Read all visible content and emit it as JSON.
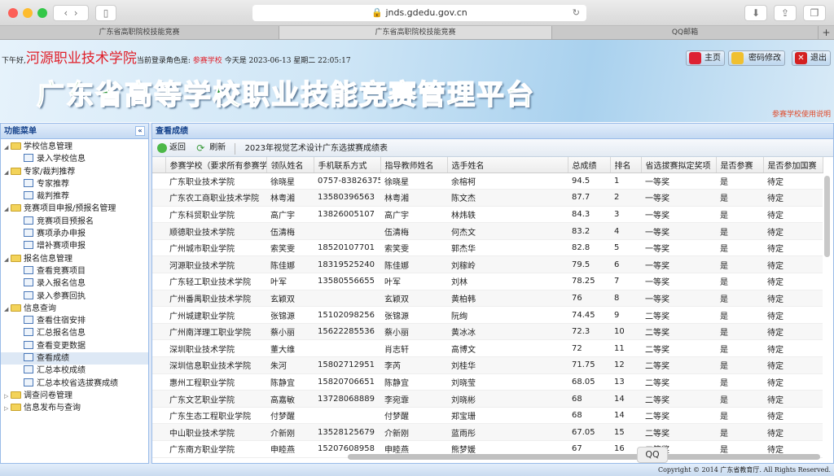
{
  "browser": {
    "url": "jnds.gdedu.gov.cn",
    "tabs": [
      "广东省高职院校技能竞赛",
      "广东省高职院校技能竞赛",
      "QQ邮箱"
    ],
    "new_tab": "+"
  },
  "header": {
    "greeting": "下午好,",
    "school": "河源职业技术学院",
    "role_prefix": "当前登录角色是:",
    "role": "参赛学校",
    "date_text": "今天是 2023-06-13 星期二 22:05:17",
    "title": "广东省高等学校职业技能竞赛管理平台",
    "buttons": {
      "home": "主页",
      "password": "密码修改",
      "logout": "退出"
    },
    "help_link": "参赛学校使用说明"
  },
  "sidebar": {
    "title": "功能菜单",
    "collapse": "«",
    "groups": [
      {
        "label": "学校信息管理",
        "open": true,
        "items": [
          "录入学校信息"
        ]
      },
      {
        "label": "专家/裁判推荐",
        "open": true,
        "items": [
          "专家推荐",
          "裁判推荐"
        ]
      },
      {
        "label": "竞赛项目申报/预报名管理",
        "open": true,
        "items": [
          "竞赛项目预报名",
          "赛项承办申报",
          "增补赛项申报"
        ]
      },
      {
        "label": "报名信息管理",
        "open": true,
        "items": [
          "查看竞赛项目",
          "录入报名信息",
          "录入参赛回执"
        ]
      },
      {
        "label": "信息查询",
        "open": true,
        "items": [
          "查看住宿安排",
          "汇总报名信息",
          "查看变更数据",
          "查看成绩",
          "汇总本校成绩",
          "汇总本校省选拔赛成绩"
        ]
      },
      {
        "label": "调查问卷管理",
        "open": false,
        "items": []
      },
      {
        "label": "信息发布与查询",
        "open": false,
        "items": []
      }
    ],
    "selected": "查看成绩"
  },
  "main": {
    "title": "查看成绩",
    "toolbar": {
      "back": "返回",
      "refresh": "刷新",
      "caption": "2023年视觉艺术设计广东选拔赛成绩表"
    },
    "columns": [
      "参赛学校（要求所有参赛学",
      "领队姓名",
      "手机联系方式",
      "指导教师姓名",
      "选手姓名",
      "总成绩",
      "排名",
      "省选拔赛拟定奖项",
      "是否参赛",
      "是否参加国赛"
    ],
    "rows": [
      [
        "广东职业技术学院",
        "徐晓星",
        "0757-83826375",
        "徐晓星",
        "余榕柯",
        "94.5",
        "1",
        "一等奖",
        "是",
        "待定"
      ],
      [
        "广东农工商职业技术学院",
        "林粤湘",
        "13580396563",
        "林粤湘",
        "陈文杰",
        "87.7",
        "2",
        "一等奖",
        "是",
        "待定"
      ],
      [
        "广东科贸职业学院",
        "高广宇",
        "13826005107",
        "高广宇",
        "林炜轶",
        "84.3",
        "3",
        "一等奖",
        "是",
        "待定"
      ],
      [
        "顺德职业技术学院",
        "伍清梅",
        "",
        "伍清梅",
        "何杰文",
        "83.2",
        "4",
        "一等奖",
        "是",
        "待定"
      ],
      [
        "广州城市职业学院",
        "索笑雯",
        "18520107701",
        "索笑雯",
        "郭杰华",
        "82.8",
        "5",
        "一等奖",
        "是",
        "待定"
      ],
      [
        "河源职业技术学院",
        "陈佳娜",
        "18319525240",
        "陈佳娜",
        "刘稼岭",
        "79.5",
        "6",
        "一等奖",
        "是",
        "待定"
      ],
      [
        "广东轻工职业技术学院",
        "叶军",
        "13580556655",
        "叶军",
        "刘林",
        "78.25",
        "7",
        "一等奖",
        "是",
        "待定"
      ],
      [
        "广州番禺职业技术学院",
        "玄颖双",
        "",
        "玄颖双",
        "黄柏韩",
        "76",
        "8",
        "一等奖",
        "是",
        "待定"
      ],
      [
        "广州城建职业学院",
        "张锦源",
        "15102098256",
        "张锦源",
        "阮绚",
        "74.45",
        "9",
        "二等奖",
        "是",
        "待定"
      ],
      [
        "广州南洋理工职业学院",
        "蔡小丽",
        "15622285536",
        "蔡小丽",
        "黄冰冰",
        "72.3",
        "10",
        "二等奖",
        "是",
        "待定"
      ],
      [
        "深圳职业技术学院",
        "董大维",
        "",
        "肖志轩",
        "高博文",
        "72",
        "11",
        "二等奖",
        "是",
        "待定"
      ],
      [
        "深圳信息职业技术学院",
        "朱河",
        "15802712951",
        "李芮",
        "刘桂华",
        "71.75",
        "12",
        "二等奖",
        "是",
        "待定"
      ],
      [
        "惠州工程职业学院",
        "陈静宜",
        "15820706651",
        "陈静宜",
        "刘晓莹",
        "68.05",
        "13",
        "二等奖",
        "是",
        "待定"
      ],
      [
        "广东文艺职业学院",
        "高嘉敏",
        "13728068889",
        "李宛霏",
        "刘晓彬",
        "68",
        "14",
        "二等奖",
        "是",
        "待定"
      ],
      [
        "广东生态工程职业学院",
        "付梦醒",
        "",
        "付梦醒",
        "郑宝珊",
        "68",
        "14",
        "二等奖",
        "是",
        "待定"
      ],
      [
        "中山职业技术学院",
        "介新刚",
        "13528125679",
        "介新刚",
        "蓝雨彤",
        "67.05",
        "15",
        "二等奖",
        "是",
        "待定"
      ],
      [
        "广东南方职业学院",
        "申睦燕",
        "15207608958",
        "申睦燕",
        "熊梦媛",
        "67",
        "16",
        "二等奖",
        "是",
        "待定"
      ]
    ]
  },
  "footer": {
    "copyright": "Copyright © 2014 广东省教育厅. All Rights Reserved."
  },
  "qq_tooltip": "QQ"
}
